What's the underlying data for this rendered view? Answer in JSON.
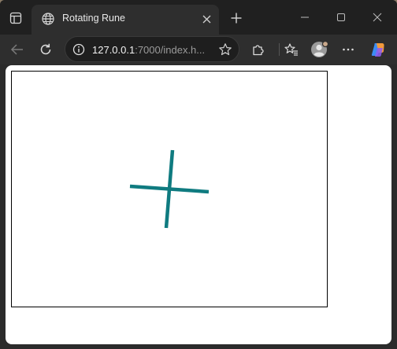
{
  "browser": {
    "tab": {
      "title": "Rotating Rune",
      "favicon": "globe-icon"
    },
    "address": {
      "host": "127.0.0.1",
      "rest": ":7000/index.h..."
    },
    "icons": {
      "tab_actions": "tab-actions-icon",
      "close_tab": "close-icon",
      "new_tab": "plus-icon",
      "minimize": "minimize-icon",
      "maximize": "maximize-icon",
      "close_window": "close-icon",
      "back": "back-arrow-icon",
      "reload": "reload-icon",
      "site_info": "info-icon",
      "favorite": "star-icon",
      "extensions": "puzzle-icon",
      "favorites": "favorites-icon",
      "profile": "avatar-icon",
      "more": "more-icon",
      "copilot": "copilot-icon"
    }
  },
  "page": {
    "rune": {
      "color": "#0f7b80",
      "shape": "cross"
    }
  }
}
